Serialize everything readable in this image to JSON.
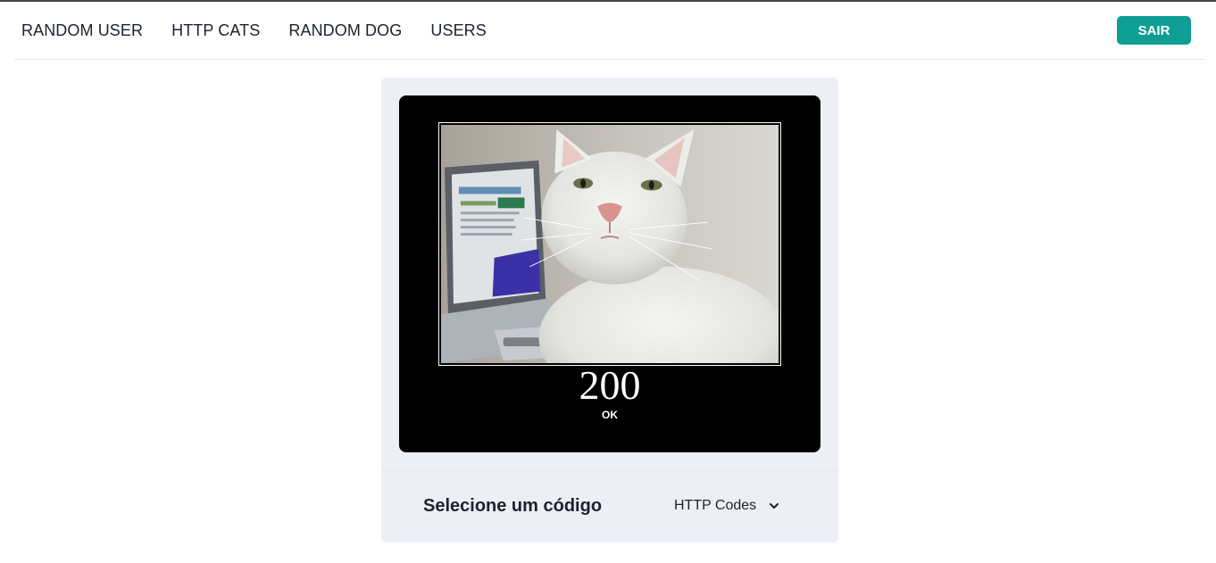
{
  "nav": {
    "links": [
      "RANDOM USER",
      "HTTP CATS",
      "RANDOM DOG",
      "USERS"
    ],
    "logout_label": "SAIR"
  },
  "card": {
    "status_code": "200",
    "status_text": "OK",
    "select_label": "Selecione um código",
    "select_value": "HTTP Codes"
  },
  "colors": {
    "accent": "#0e9e94",
    "card_bg": "#eceff5",
    "frame_bg": "#000000"
  },
  "icons": [
    "chevron-down-icon"
  ]
}
